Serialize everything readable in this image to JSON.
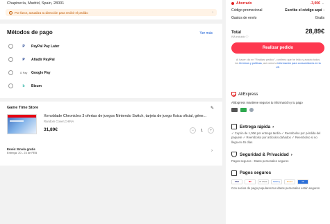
{
  "address": {
    "text": "Chapinería, Madrid, Spain, 28001",
    "warning": "Por favor, actualiza tu dirección para recibir el pedido"
  },
  "payment": {
    "title": "Métodos de pago",
    "more_link": "Ver más",
    "methods": [
      {
        "label": "PayPal Pay Later",
        "logo": "P"
      },
      {
        "label": "Añadir PayPal",
        "logo": "P"
      },
      {
        "label": "Google Pay",
        "logo": "G Pay"
      },
      {
        "label": "Bizum",
        "logo": "b"
      }
    ]
  },
  "store": {
    "name": "Game Time Store",
    "product_title": "Xenoblade Chronicles 3 ofertas de juegos Nintendo Switch, tarjeta de juego física oficial, géne...",
    "seller_note": "Random Cover,CHINA",
    "price": "31,89€",
    "quantity": "1",
    "shipping_title": "Envío: Envío gratis",
    "shipping_date": "Entrega: 20 - 23 de FEB"
  },
  "summary": {
    "saving_label": "Ahorrado",
    "saving_value": "-3,00€",
    "coupon_label": "Código promocional",
    "coupon_value": "Escribe el código aquí",
    "shipping_label": "Gastos de envío",
    "shipping_value": "Gratis",
    "total_label": "Total",
    "total_value": "28,89€",
    "iva": "IVA incluido",
    "order_button": "Realizar pedido",
    "legal_1": "Al hacer clic en \"Realizar pedido\", confirmo que he leído y acepto todos los",
    "legal_link_1": "términos y políticas",
    "legal_2": ", así como la",
    "legal_link_2": "información para consumidores en la UE."
  },
  "trust": {
    "brand": "AliExpress",
    "text": "AliExpress mantiene seguros tu información y tu pago",
    "delivery_title": "Entrega rápida",
    "delivery_items": "✓ Cupón de 1,00€ por entrega tardía ✓ Reembolso por pérdida del paquete ✓ Reembolso por artículos dañados ✓ Reembolso si no llega en 45 días",
    "privacy_title": "Seguridad & Privacidad",
    "privacy_desc": "Pagos seguros · Datos personales seguros",
    "payments_title": "Pagos seguros",
    "payments_desc": "Con socios de pago populares tus datos personales están seguros",
    "logos": [
      "VISA",
      "MC",
      "ID Check",
      "SafeKey",
      "Protect",
      "AE"
    ]
  },
  "colors": {
    "accent": "#fd384f",
    "link": "#1a5fd6",
    "warning_bg": "#fff3e6"
  }
}
